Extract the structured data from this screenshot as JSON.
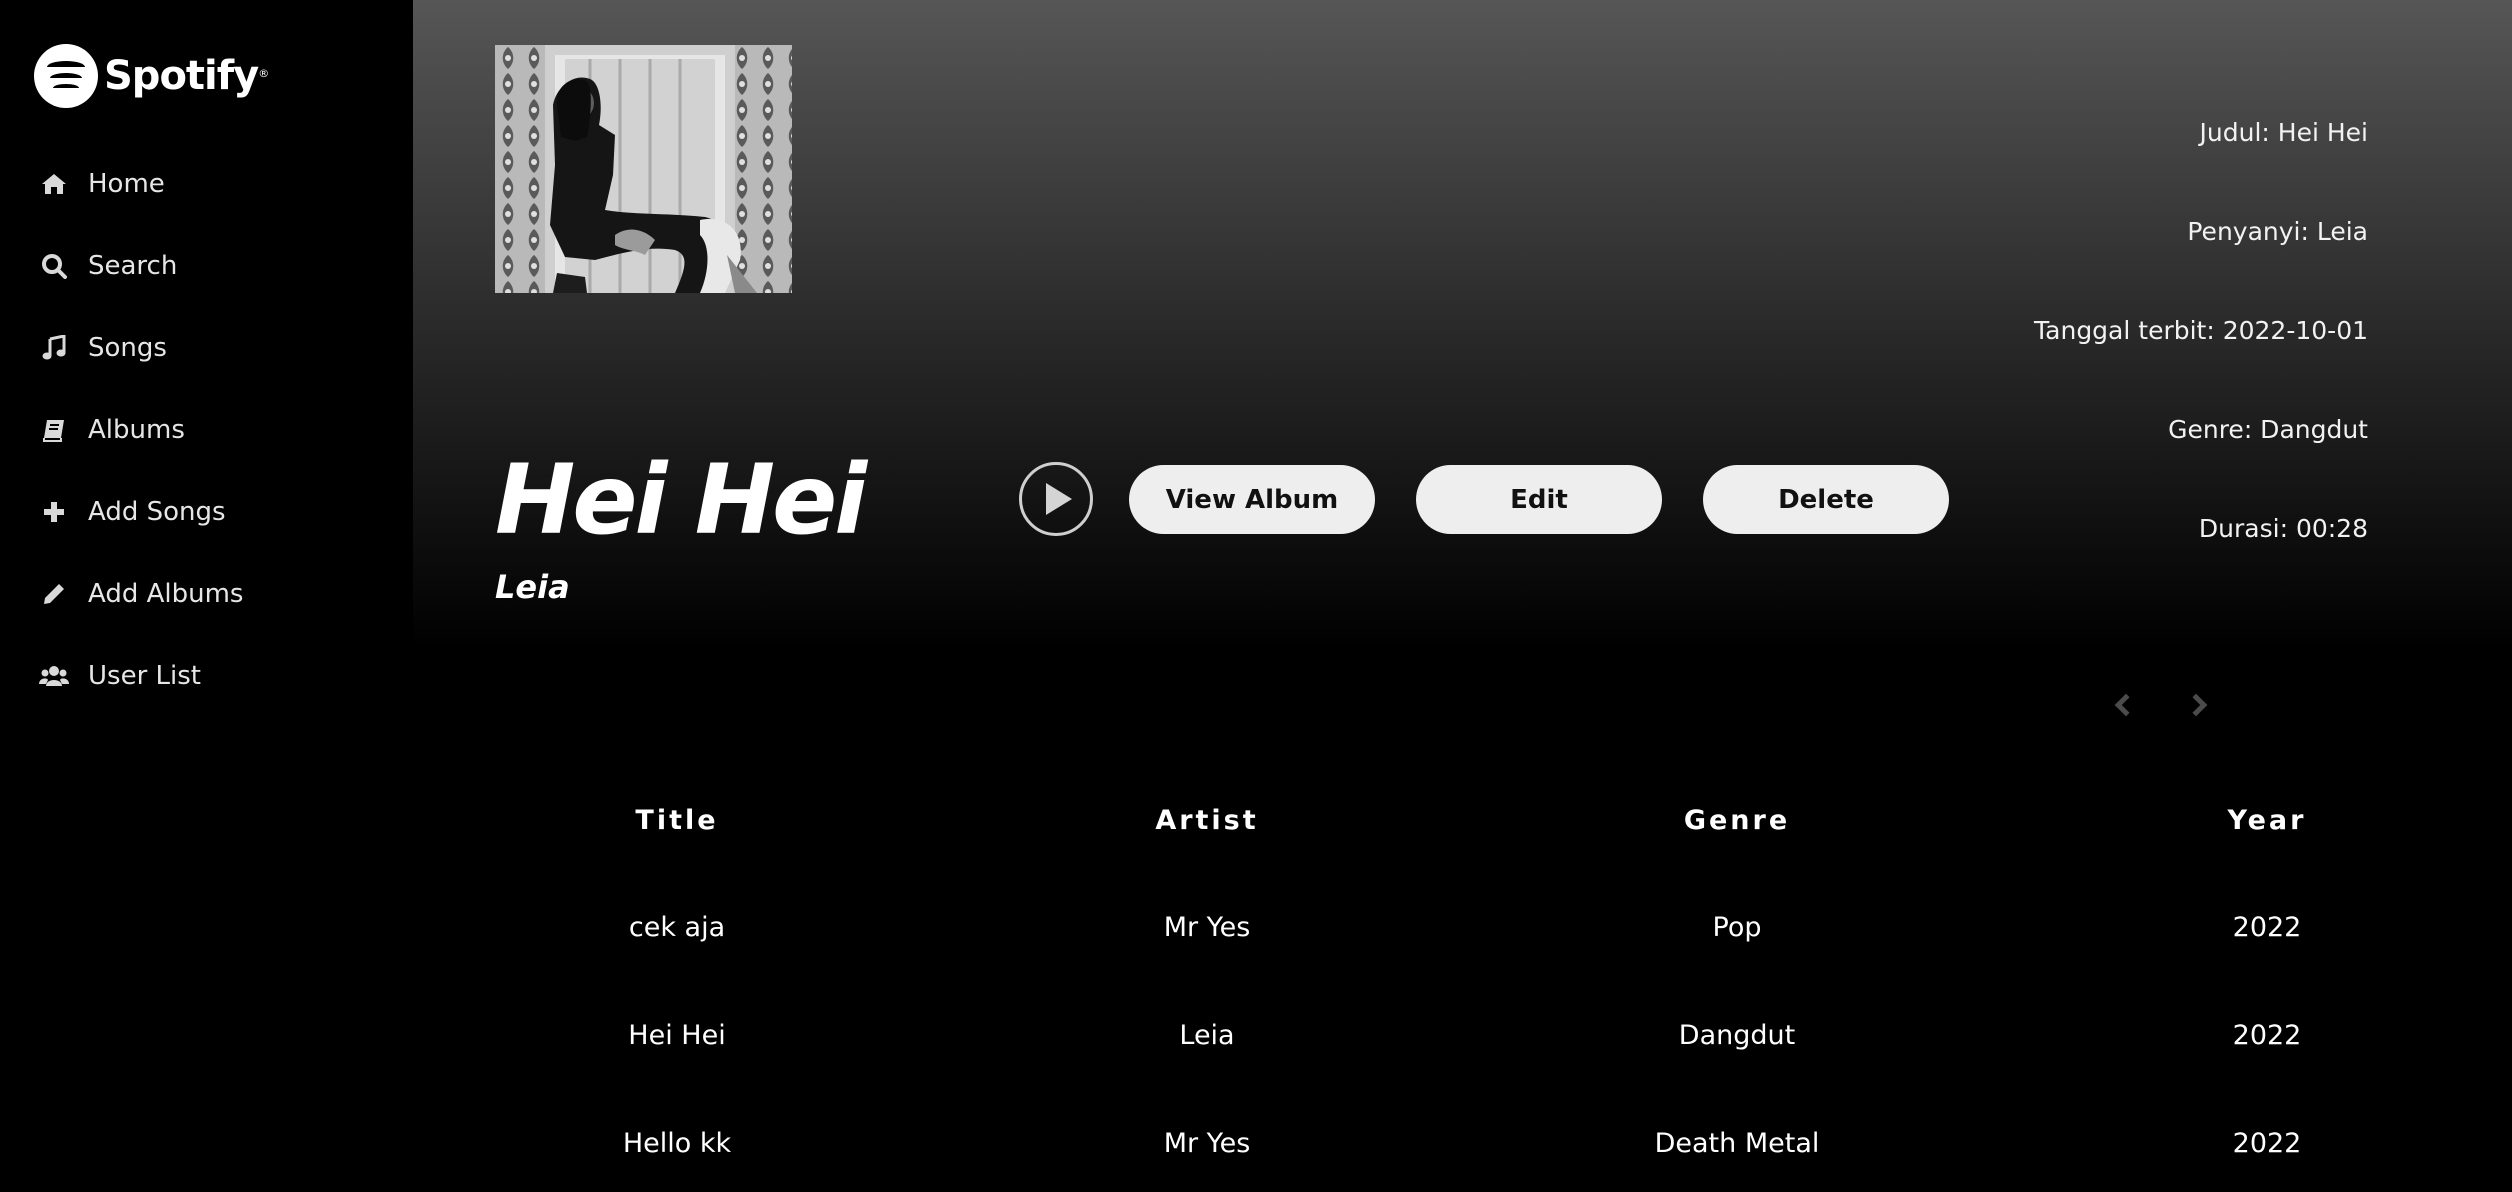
{
  "brand": {
    "name": "Spotify",
    "mark": "®"
  },
  "sidebar": {
    "items": [
      {
        "label": "Home",
        "icon": "home-icon"
      },
      {
        "label": "Search",
        "icon": "search-icon"
      },
      {
        "label": "Songs",
        "icon": "music-note-icon"
      },
      {
        "label": "Albums",
        "icon": "book-icon"
      },
      {
        "label": "Add Songs",
        "icon": "plus-icon"
      },
      {
        "label": "Add Albums",
        "icon": "pencil-icon"
      },
      {
        "label": "User List",
        "icon": "users-icon"
      }
    ]
  },
  "song": {
    "title": "Hei Hei",
    "artist": "Leia"
  },
  "actions": {
    "view_album": "View Album",
    "edit": "Edit",
    "delete": "Delete"
  },
  "details": {
    "judul": "Judul: Hei Hei",
    "penyanyi": "Penyanyi: Leia",
    "tanggal": "Tanggal terbit: 2022-10-01",
    "genre": "Genre: Dangdut",
    "durasi": "Durasi: 00:28"
  },
  "table": {
    "headers": [
      "Title",
      "Artist",
      "Genre",
      "Year"
    ],
    "rows": [
      [
        "cek aja",
        "Mr Yes",
        "Pop",
        "2022"
      ],
      [
        "Hei Hei",
        "Leia",
        "Dangdut",
        "2022"
      ],
      [
        "Hello kk",
        "Mr Yes",
        "Death Metal",
        "2022"
      ]
    ]
  },
  "colors": {
    "background": "#000000",
    "hero_top": "#575657",
    "button_bg": "#eeeeee",
    "text": "#ffffff"
  }
}
